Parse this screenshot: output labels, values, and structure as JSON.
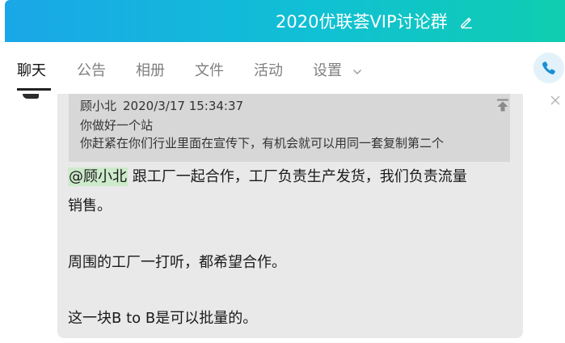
{
  "header": {
    "title": "2020优联荟VIP讨论群",
    "edit_icon": "pencil-icon",
    "gradient_start": "#1aa7e8",
    "gradient_end": "#0fcdb0"
  },
  "tabs": [
    {
      "label": "聊天",
      "active": true
    },
    {
      "label": "公告",
      "active": false
    },
    {
      "label": "相册",
      "active": false
    },
    {
      "label": "文件",
      "active": false
    },
    {
      "label": "活动",
      "active": false
    },
    {
      "label": "设置",
      "active": false
    }
  ],
  "call_button_icon": "phone-icon",
  "message": {
    "quote": {
      "author": "顾小北",
      "time": "2020/3/17 15:34:37",
      "line1": "你做好一个站",
      "line2": "你赶紧在你们行业里面在宣传下，有机会就可以用同一套复制第二个"
    },
    "mention": "@顾小北",
    "line1_rest": " 跟工厂一起合作，工厂负责生产发货，我们负责流量",
    "line1_cont": "销售。",
    "line2": "周围的工厂一打听，都希望合作。",
    "line3": "这一块B to B是可以批量的。"
  }
}
